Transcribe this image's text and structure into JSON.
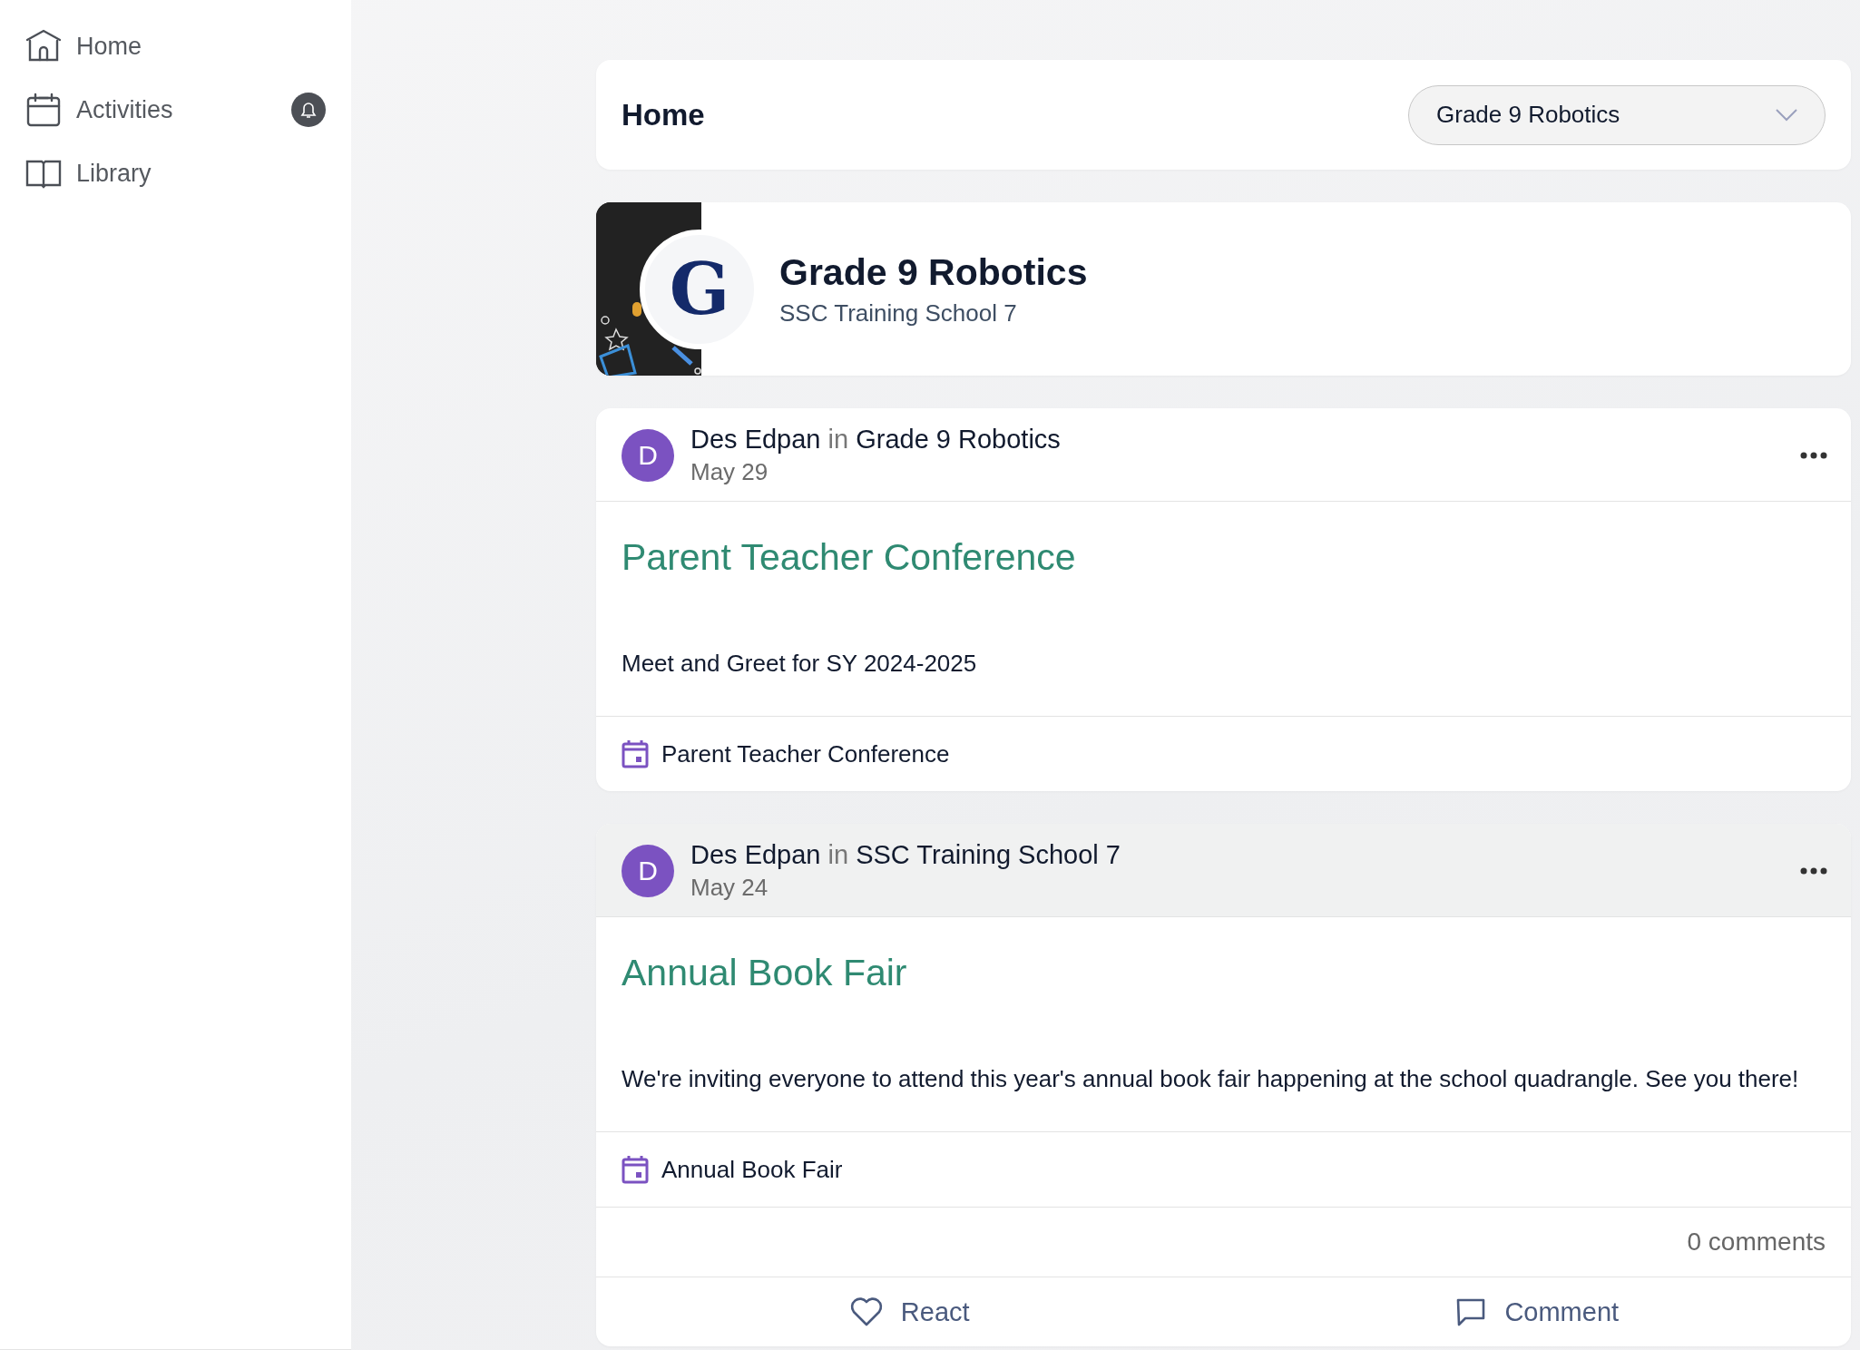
{
  "sidebar": {
    "items": [
      {
        "label": "Home",
        "notification": false
      },
      {
        "label": "Activities",
        "notification": true
      },
      {
        "label": "Library",
        "notification": false
      }
    ]
  },
  "header": {
    "title": "Home",
    "group_select": {
      "value": "Grade 9 Robotics"
    }
  },
  "group": {
    "name": "Grade 9 Robotics",
    "initial": "G",
    "school": "SSC Training School 7"
  },
  "posts": [
    {
      "author": "Des Edpan",
      "author_initial": "D",
      "connector": "in",
      "place": "Grade 9 Robotics",
      "date": "May 29",
      "highlighted": false,
      "title": "Parent Teacher Conference",
      "body": "Meet and Greet for SY 2024-2025",
      "event": "Parent Teacher Conference"
    },
    {
      "author": "Des Edpan",
      "author_initial": "D",
      "connector": "in",
      "place": "SSC Training School 7",
      "date": "May 24",
      "highlighted": true,
      "title": "Annual Book Fair",
      "body": "We're inviting everyone to attend this year's annual book fair happening at the school quadrangle. See you there!",
      "event": "Annual Book Fair",
      "comments": "0 comments",
      "actions": [
        {
          "label": "React"
        },
        {
          "label": "Comment"
        }
      ]
    }
  ]
}
